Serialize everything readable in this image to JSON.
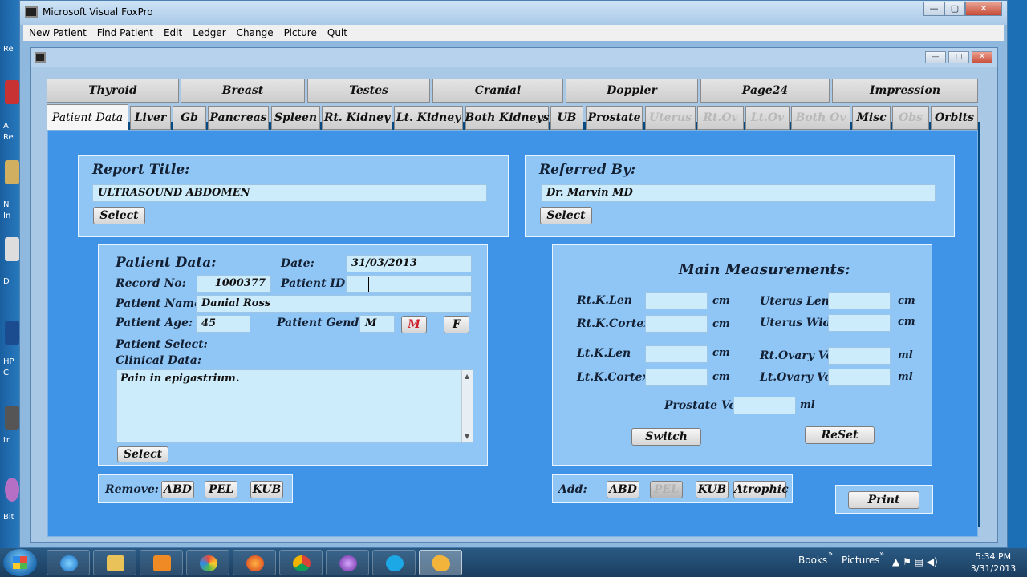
{
  "window": {
    "title": "Microsoft Visual FoxPro",
    "buttons": [
      "—",
      "▢",
      "✕"
    ]
  },
  "menu": [
    "New Patient",
    "Find Patient",
    "Edit",
    "Ledger",
    "Change",
    "Picture",
    "Quit"
  ],
  "inner_window": {
    "buttons": [
      "—",
      "▢",
      "✕"
    ]
  },
  "tabs": {
    "row1": [
      "Thyroid",
      "Breast",
      "Testes",
      "Cranial",
      "Doppler",
      "Page24",
      "Impression"
    ],
    "row2": [
      "Patient Data",
      "Liver",
      "Gb",
      "Pancreas",
      "Spleen",
      "Rt. Kidney",
      "Lt. Kidney",
      "Both Kidneys",
      "UB",
      "Prostate",
      "Uterus",
      "Rt.Ov",
      "Lt.Ov",
      "Both Ov",
      "Misc",
      "Obs",
      "Orbits"
    ],
    "active": "Patient Data",
    "disabled": [
      "Uterus",
      "Rt.Ov",
      "Lt.Ov",
      "Both Ov",
      "Obs"
    ]
  },
  "report": {
    "label": "Report Title:",
    "value": "ULTRASOUND ABDOMEN",
    "select": "Select"
  },
  "referred": {
    "label": "Referred By:",
    "value": "Dr. Marvin MD",
    "select": "Select"
  },
  "patient": {
    "heading": "Patient Data:",
    "date_label": "Date:",
    "date": "31/03/2013",
    "record_label": "Record No:",
    "record": "1000377",
    "pid_label": "Patient ID:",
    "pid": "",
    "name_label": "Patient Name:",
    "name": "Danial Ross",
    "age_label": "Patient Age:",
    "age": "45",
    "gender_label": "Patient Gender:",
    "gender": "M",
    "gender_m": "M",
    "gender_f": "F",
    "select_label": "Patient Select:",
    "clinical_label": "Clinical Data:",
    "clinical": "Pain in epigastrium.",
    "select_btn": "Select"
  },
  "remove": {
    "label": "Remove:",
    "buttons": [
      "ABD",
      "PEL",
      "KUB"
    ]
  },
  "measurements": {
    "title": "Main Measurements:",
    "rows": [
      {
        "label": "Rt.K.Len",
        "unit": "cm",
        "value": ""
      },
      {
        "label": "Rt.K.Cortex",
        "unit": "cm",
        "value": ""
      },
      {
        "label": "Lt.K.Len",
        "unit": "cm",
        "value": ""
      },
      {
        "label": "Lt.K.Cortex",
        "unit": "cm",
        "value": ""
      },
      {
        "label": "Uterus Len:",
        "unit": "cm",
        "value": ""
      },
      {
        "label": "Uterus Width",
        "unit": "cm",
        "value": ""
      },
      {
        "label": "Rt.Ovary Vol",
        "unit": "ml",
        "value": ""
      },
      {
        "label": "Lt.Ovary Vol",
        "unit": "ml",
        "value": ""
      },
      {
        "label": "Prostate Vol:",
        "unit": "ml",
        "value": ""
      }
    ],
    "switch": "Switch",
    "reset": "ReSet"
  },
  "add": {
    "label": "Add:",
    "buttons": [
      "ABD",
      "PEL",
      "KUB",
      "Atrophic"
    ],
    "disabled": "PEL"
  },
  "print": "Print",
  "desktop_icons": [
    "Re",
    "A",
    "Re",
    "N",
    "In",
    "D",
    "HP",
    "C",
    "tr",
    "Bit"
  ],
  "taskbar": {
    "apps": [
      "internet-explorer",
      "file-explorer",
      "media-player",
      "paint",
      "firefox",
      "chrome",
      "app-purple",
      "skype",
      "foxpro"
    ],
    "toolbars": [
      "Books",
      "Pictures"
    ],
    "time": "5:34 PM",
    "date": "3/31/2013"
  }
}
